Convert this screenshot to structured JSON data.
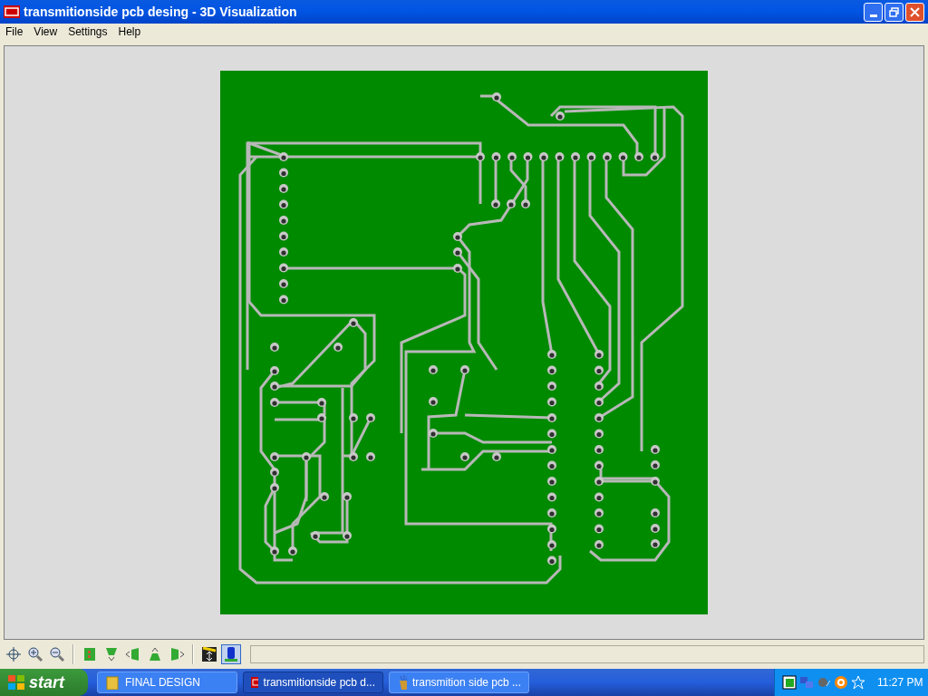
{
  "window": {
    "title": "transmitionside pcb desing - 3D Visualization"
  },
  "menu": [
    "File",
    "View",
    "Settings",
    "Help"
  ],
  "toolbar": [
    [
      {
        "kind": "crosshair",
        "selected": false
      },
      {
        "kind": "zoom-in",
        "selected": false
      },
      {
        "kind": "zoom-out",
        "selected": false
      }
    ],
    [
      {
        "kind": "top-view",
        "selected": false
      },
      {
        "kind": "front-view",
        "selected": false
      },
      {
        "kind": "left-view",
        "selected": false
      },
      {
        "kind": "back-view",
        "selected": false
      },
      {
        "kind": "right-view",
        "selected": false
      }
    ],
    [
      {
        "kind": "height",
        "selected": false
      },
      {
        "kind": "component",
        "selected": true
      }
    ]
  ],
  "taskbar": {
    "start": "start",
    "tasks": [
      {
        "kind": "folder",
        "label": "FINAL DESIGN",
        "selected": false
      },
      {
        "kind": "ares",
        "label": "transmitionside pcb d...",
        "selected": true
      },
      {
        "kind": "isis",
        "label": "transmition  side pcb ...",
        "selected": false
      }
    ],
    "clock": "11:27 PM"
  }
}
